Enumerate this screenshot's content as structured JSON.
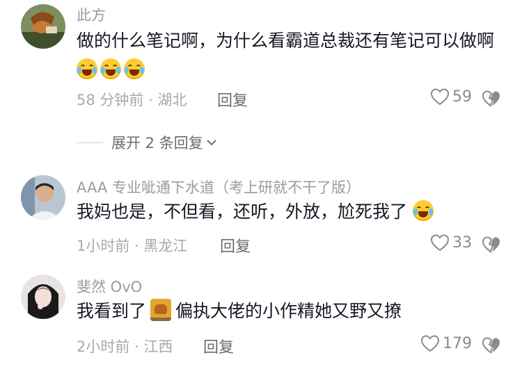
{
  "comments": [
    {
      "username": "此方",
      "text": "做的什么笔记啊，为什么看霸道总裁还有笔记可以做啊",
      "emojis": [
        "laugh-cry-emoji",
        "laugh-cry-emoji",
        "laugh-cry-emoji"
      ],
      "time_location": "58 分钟前 · 湖北",
      "reply_label": "回复",
      "likes": "59",
      "avatar_color": "#5b7a4e"
    },
    {
      "username": "AAA 专业呲通下水道（考上研就不干了版）",
      "text": "我妈也是，不但看，还听，外放，尬死我了",
      "emojis": [
        "grin-sweat-emoji"
      ],
      "time_location": "1小时前 · 黑龙江",
      "reply_label": "回复",
      "likes": "33",
      "avatar_color": "#c8d2dc"
    },
    {
      "username": "斐然 OvO",
      "text_before": "我看到了",
      "text_after": "偏执大佬的小作精她又野又撩",
      "time_location": "2小时前 · 江西",
      "reply_label": "回复",
      "likes": "179",
      "avatar_color": "#2b2b2b"
    }
  ],
  "expand_replies": "展开 2 条回复",
  "colors": {
    "text": "#161823",
    "secondary": "#9a9aa0",
    "emoji": "#ffcc33"
  }
}
